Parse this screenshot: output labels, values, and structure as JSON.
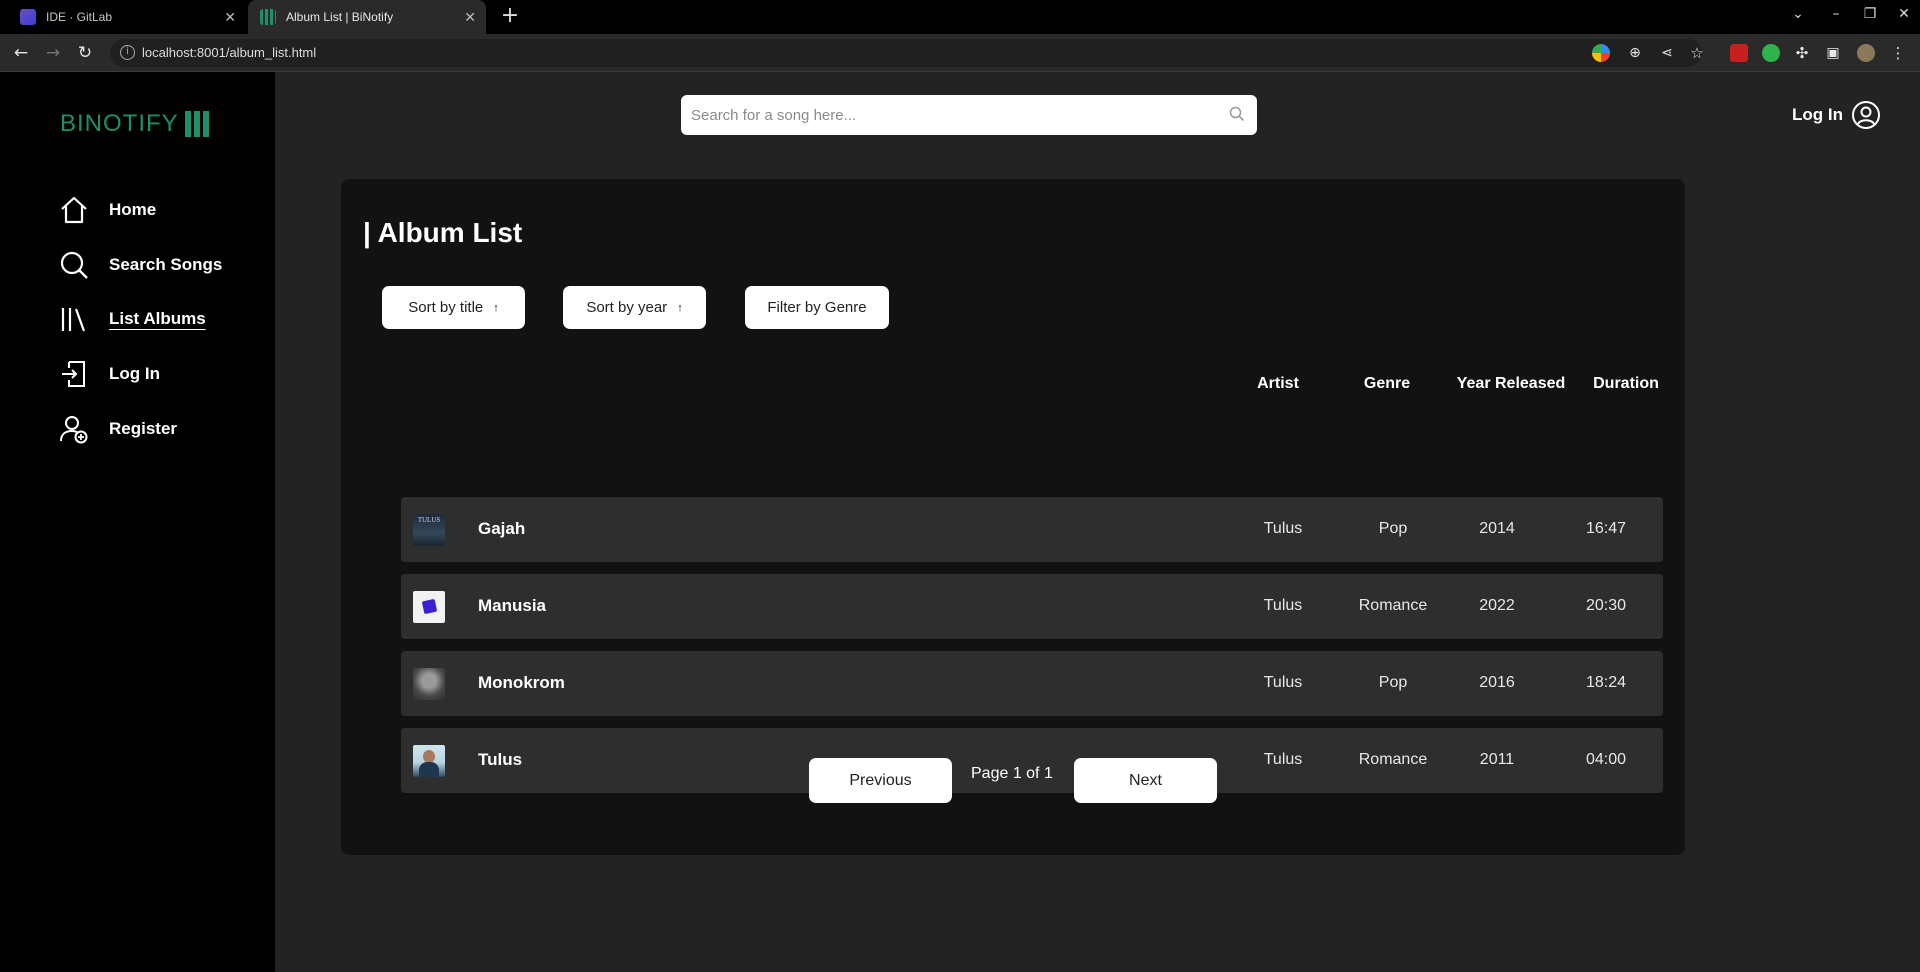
{
  "browser": {
    "tabs": [
      {
        "title": "IDE · GitLab",
        "active": false
      },
      {
        "title": "Album List | BiNotify",
        "active": true
      }
    ],
    "url": "localhost:8001/album_list.html"
  },
  "sidebar": {
    "logo": "BINOTIFY",
    "items": [
      {
        "label": "Home",
        "icon": "home-icon"
      },
      {
        "label": "Search Songs",
        "icon": "search-icon"
      },
      {
        "label": "List Albums",
        "icon": "library-icon",
        "active": true
      },
      {
        "label": "Log In",
        "icon": "login-icon"
      },
      {
        "label": "Register",
        "icon": "register-icon"
      }
    ]
  },
  "search": {
    "placeholder": "Search for a song here..."
  },
  "header": {
    "login_label": "Log In"
  },
  "main": {
    "title": "| Album List",
    "controls": {
      "sort_title": "Sort by title",
      "sort_year": "Sort by year",
      "sort_arrow": "↑",
      "filter_genre": "Filter by Genre"
    },
    "columns": [
      "Artist",
      "Genre",
      "Year Released",
      "Duration"
    ],
    "albums": [
      {
        "title": "Gajah",
        "artist": "Tulus",
        "genre": "Pop",
        "year": "2014",
        "duration": "16:47"
      },
      {
        "title": "Manusia",
        "artist": "Tulus",
        "genre": "Romance",
        "year": "2022",
        "duration": "20:30"
      },
      {
        "title": "Monokrom",
        "artist": "Tulus",
        "genre": "Pop",
        "year": "2016",
        "duration": "18:24"
      },
      {
        "title": "Tulus",
        "artist": "Tulus",
        "genre": "Romance",
        "year": "2011",
        "duration": "04:00"
      }
    ],
    "pagination": {
      "prev": "Previous",
      "page_info": "Page 1 of 1",
      "next": "Next"
    }
  },
  "colors": {
    "brand": "#1f8f6a",
    "panel": "#121212",
    "row": "#2e2e2e",
    "sidebar": "#000000"
  }
}
